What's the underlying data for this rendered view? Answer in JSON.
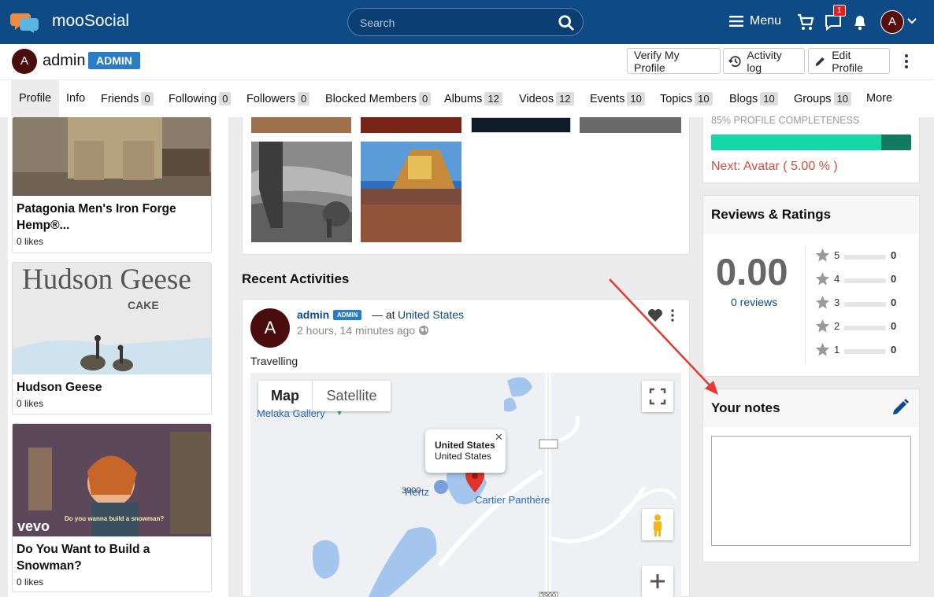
{
  "app": {
    "name": "mooSocial"
  },
  "search": {
    "placeholder": "Search"
  },
  "topnav": {
    "menu_label": "Menu",
    "message_badge": "1",
    "avatar_initial": "A"
  },
  "profile": {
    "avatar_initial": "A",
    "name": "admin",
    "role_badge": "ADMIN",
    "buttons": {
      "verify": "Verify My Profile",
      "activity": "Activity log",
      "edit": "Edit Profile"
    }
  },
  "tabs": [
    {
      "label": "Profile"
    },
    {
      "label": "Info"
    },
    {
      "label": "Friends",
      "count": "0"
    },
    {
      "label": "Following",
      "count": "0"
    },
    {
      "label": "Followers",
      "count": "0"
    },
    {
      "label": "Blocked Members",
      "count": "0"
    },
    {
      "label": "Albums",
      "count": "12"
    },
    {
      "label": "Videos",
      "count": "12"
    },
    {
      "label": "Events",
      "count": "10"
    },
    {
      "label": "Topics",
      "count": "10"
    },
    {
      "label": "Blogs",
      "count": "10"
    },
    {
      "label": "Groups",
      "count": "10"
    },
    {
      "label": "More"
    }
  ],
  "left_cards": [
    {
      "title": "Patagonia Men's Iron Forge Hemp®...",
      "likes": "0 likes"
    },
    {
      "title": "Hudson Geese",
      "likes": "0 likes",
      "poster_text": "Hudson Geese",
      "poster_sub": "CAKE"
    },
    {
      "title": "Do You Want to Build a Snowman?",
      "likes": "0 likes",
      "video_brand": "vevo",
      "caption": "Do you wanna build a snowman?"
    }
  ],
  "recent": {
    "heading": "Recent Activities",
    "post": {
      "avatar_initial": "A",
      "author": "admin",
      "badge": "ADMIN",
      "at_text": "— at",
      "location": "United States",
      "time": "2 hours, 14 minutes ago",
      "text": "Travelling"
    }
  },
  "map": {
    "toggle_map": "Map",
    "toggle_satellite": "Satellite",
    "info_title": "United States",
    "info_sub": "United States",
    "labels": {
      "gallery": "Melaka Gallery",
      "hertz": "Hertz",
      "cartier": "Cartier Panthère",
      "road1": "3900",
      "road2": "3900"
    }
  },
  "completeness": {
    "label": "85% PROFILE COMPLETENESS",
    "percent": 85,
    "next": "Next: Avatar ( 5.00 % )"
  },
  "reviews": {
    "title": "Reviews & Ratings",
    "score": "0.00",
    "count": "0 reviews",
    "rows": [
      {
        "stars": "5",
        "value": "0"
      },
      {
        "stars": "4",
        "value": "0"
      },
      {
        "stars": "3",
        "value": "0"
      },
      {
        "stars": "2",
        "value": "0"
      },
      {
        "stars": "1",
        "value": "0"
      }
    ]
  },
  "notes": {
    "title": "Your notes"
  },
  "colors": {
    "brand": "#0d4a86",
    "badge": "#2a7dc5",
    "progress": "#14d9a6",
    "warning": "#d84a3a"
  }
}
